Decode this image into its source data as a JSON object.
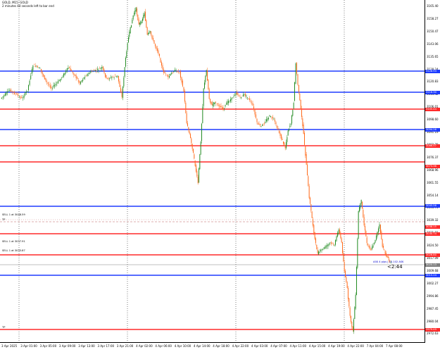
{
  "header": {
    "symbol_line": "GOLD, M15: GOLD",
    "countdown_line": "2 minutes 44 seconds left to bar end"
  },
  "price_axis": {
    "ticks": [
      "3165.40",
      "3158.27",
      "3150.47",
      "3143.06",
      "3135.65",
      "3128.24",
      "3120.83",
      "3113.42",
      "3106.01",
      "3098.60",
      "3091.19",
      "3083.78",
      "3076.37",
      "3068.96",
      "3061.55",
      "3054.14",
      "3046.73",
      "3039.32",
      "3031.91",
      "3024.50",
      "3017.09",
      "3009.68",
      "3002.27",
      "2994.86",
      "2987.45",
      "2980.04",
      "2972.63"
    ],
    "tags": [
      {
        "text": "3128.93",
        "color": "#1e3cff"
      },
      {
        "text": "3116.30",
        "color": "#1e3cff"
      },
      {
        "text": "3105.44",
        "color": "#ff2a2a"
      },
      {
        "text": "3094.26",
        "color": "#1e3cff"
      },
      {
        "text": "3086.57",
        "color": "#ff2a2a"
      },
      {
        "text": "3073.36",
        "color": "#ff2a2a"
      },
      {
        "text": "3045.56",
        "color": "#1e3cff"
      },
      {
        "text": "3038.15",
        "color": "#ff2a2a"
      },
      {
        "text": "3030.74",
        "color": "#ff2a2a"
      },
      {
        "text": "3026.80",
        "color": "#ff2a2a"
      },
      {
        "text": "3020.13",
        "color": "#808080"
      },
      {
        "text": "3015.24",
        "color": "#1e3cff"
      },
      {
        "text": "2979.49",
        "color": "#ff2a2a"
      }
    ]
  },
  "time_axis": {
    "ticks": [
      "3 Apr 2025",
      "3 Apr 01:00",
      "3 Apr 05:00",
      "3 Apr 09:00",
      "3 Apr 13:00",
      "3 Apr 17:00",
      "3 Apr 21:00",
      "4 Apr 02:00",
      "4 Apr 06:00",
      "4 Apr 10:00",
      "4 Apr 14:00",
      "4 Apr 18:00",
      "4 Apr 22:00",
      "4 Apr 03:00",
      "4 Apr 07:00",
      "4 Apr 11:00",
      "4 Apr 15:00",
      "4 Apr 19:00",
      "4 Apr 22:00",
      "7 Apr 04:00",
      "7 Apr 08:00"
    ]
  },
  "orders": {
    "sell_1": "SELL 1 at 3048.59",
    "tp_1": "TP",
    "sell_2": "SELL 1 at 3037.91",
    "sell_3": "SELL 1 at 3033.87",
    "tp_bottom": "TP",
    "last_price_label": "ASK 4 pips | 10.102 ASK",
    "countdown": "<2:44"
  },
  "colors": {
    "bull": "#228b22",
    "bear": "#ff6a1a",
    "level_blue": "#1e3cff",
    "level_red": "#ff2a2a",
    "grid": "#000000",
    "background": "#ffffff"
  }
}
